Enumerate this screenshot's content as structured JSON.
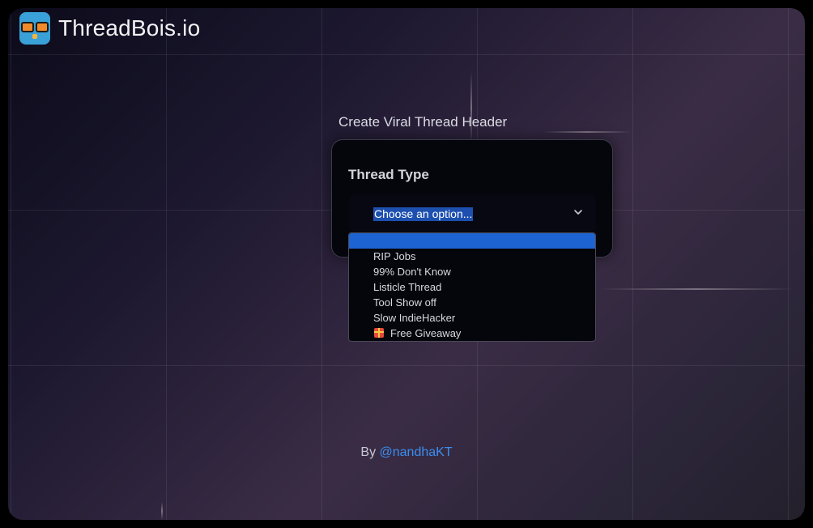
{
  "brand": {
    "name": "ThreadBois.io",
    "logo_icon": "owl-with-sunglasses-icon"
  },
  "form": {
    "section_title": "Create Viral Thread Header",
    "field_label": "Thread Type",
    "select_value": "Choose an option...",
    "chevron_icon": "chevron-down-icon"
  },
  "dropdown": {
    "options": [
      {
        "label": ""
      },
      {
        "label": "RIP Jobs"
      },
      {
        "label": "99% Don't Know"
      },
      {
        "label": "Listicle Thread"
      },
      {
        "label": "Tool Show off"
      },
      {
        "label": "Slow IndieHacker"
      },
      {
        "label": "Free Giveaway",
        "icon": "gift-icon"
      }
    ]
  },
  "footer": {
    "prefix": "By",
    "author_link": "@nandhaKT"
  },
  "colors": {
    "accent_link": "#3b8ef0",
    "highlight": "#1d64d2",
    "selection": "#1c4fae"
  }
}
